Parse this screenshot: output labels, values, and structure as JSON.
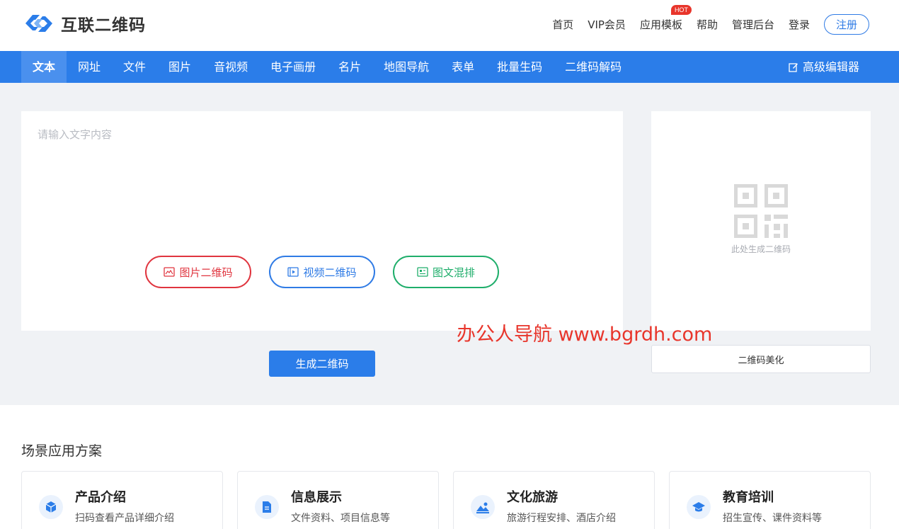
{
  "header": {
    "logo_text": "互联二维码",
    "nav": [
      {
        "label": "首页"
      },
      {
        "label": "VIP会员"
      },
      {
        "label": "应用模板",
        "badge": "HOT"
      },
      {
        "label": "帮助"
      },
      {
        "label": "管理后台"
      },
      {
        "label": "登录"
      }
    ],
    "register_label": "注册"
  },
  "navbar": {
    "tabs": [
      "文本",
      "网址",
      "文件",
      "图片",
      "音视频",
      "电子画册",
      "名片",
      "地图导航",
      "表单",
      "批量生码",
      "二维码解码"
    ],
    "active_tab": "文本",
    "advanced_editor": "高级编辑器"
  },
  "editor": {
    "placeholder": "请输入文字内容",
    "value": "",
    "buttons": {
      "image_qr": "图片二维码",
      "video_qr": "视频二维码",
      "mixed": "图文混排"
    },
    "generate_label": "生成二维码"
  },
  "preview": {
    "hint": "此处生成二维码",
    "beautify_label": "二维码美化"
  },
  "watermark": "办公人导航  www.bgrdh.com",
  "scenarios": {
    "title": "场景应用方案",
    "cards": [
      {
        "title": "产品介绍",
        "desc": "扫码查看产品详细介绍",
        "icon": "cube-icon"
      },
      {
        "title": "信息展示",
        "desc": "文件资料、项目信息等",
        "icon": "document-icon"
      },
      {
        "title": "文化旅游",
        "desc": "旅游行程安排、酒店介绍",
        "icon": "landscape-icon"
      },
      {
        "title": "教育培训",
        "desc": "招生宣传、课件资料等",
        "icon": "graduation-cap-icon"
      }
    ]
  },
  "colors": {
    "brand_blue": "#2b7de9",
    "red": "#e0353f",
    "green": "#1fae6b",
    "hot": "#e8352b"
  }
}
